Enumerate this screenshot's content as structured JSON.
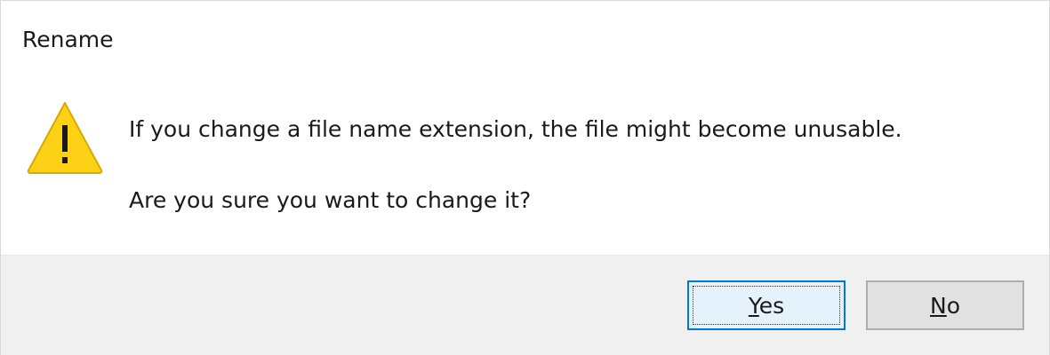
{
  "dialog": {
    "title": "Rename",
    "icon": "warning-triangle-icon",
    "message_line1": "If you change a file name extension, the file might become unusable.",
    "message_line2": "Are you sure you want to change it?"
  },
  "buttons": {
    "yes_access_key": "Y",
    "yes_rest": "es",
    "no_access_key": "N",
    "no_rest": "o"
  },
  "colors": {
    "warning_fill": "#fcd116",
    "focus_border": "#0078d7",
    "footer_bg": "#f0f0f0"
  }
}
